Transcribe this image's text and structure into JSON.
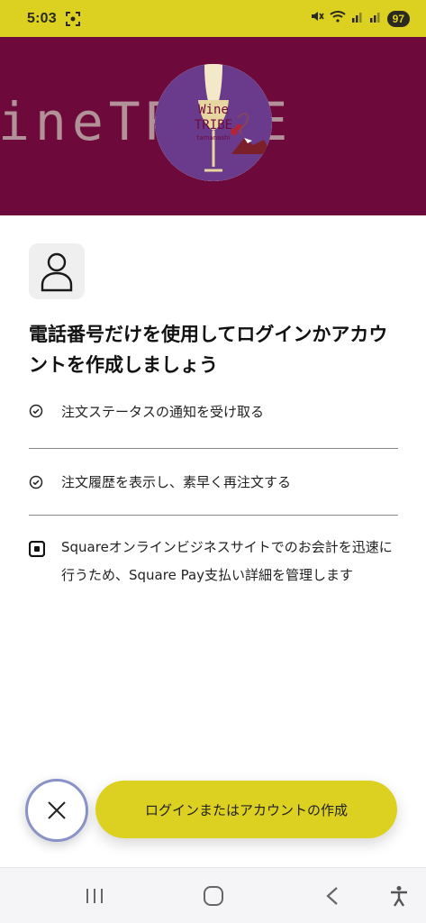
{
  "status_bar": {
    "time": "5:03",
    "battery": "97",
    "icons": [
      "screenshot-icon",
      "mute-icon",
      "wifi-icon",
      "signal-icon",
      "signal-icon-2"
    ]
  },
  "banner": {
    "bg_text": "ineTRIBE",
    "logo": {
      "line1": "Wine",
      "line2": "TRIBE",
      "line3": "tamanashi"
    }
  },
  "content": {
    "icon": "person-icon",
    "heading": "電話番号だけを使用してログインかアカウントを作成しましょう",
    "features": [
      {
        "icon": "check-circle-icon",
        "text": "注文ステータスの通知を受け取る"
      },
      {
        "icon": "check-circle-icon",
        "text": "注文履歴を表示し、素早く再注文する"
      }
    ],
    "square_note": {
      "icon": "square-logo-icon",
      "text": "Squareオンラインビジネスサイトでのお会計を迅速に行うため、Square Pay支払い詳細を管理します"
    }
  },
  "actions": {
    "close_icon": "close-icon",
    "primary_label": "ログインまたはアカウントの作成"
  },
  "colors": {
    "accent": "#dcd020",
    "banner": "#6d0a3b",
    "fab_border": "#8a93c8"
  },
  "nav": [
    "recent-apps-icon",
    "home-icon",
    "back-icon",
    "accessibility-icon"
  ]
}
